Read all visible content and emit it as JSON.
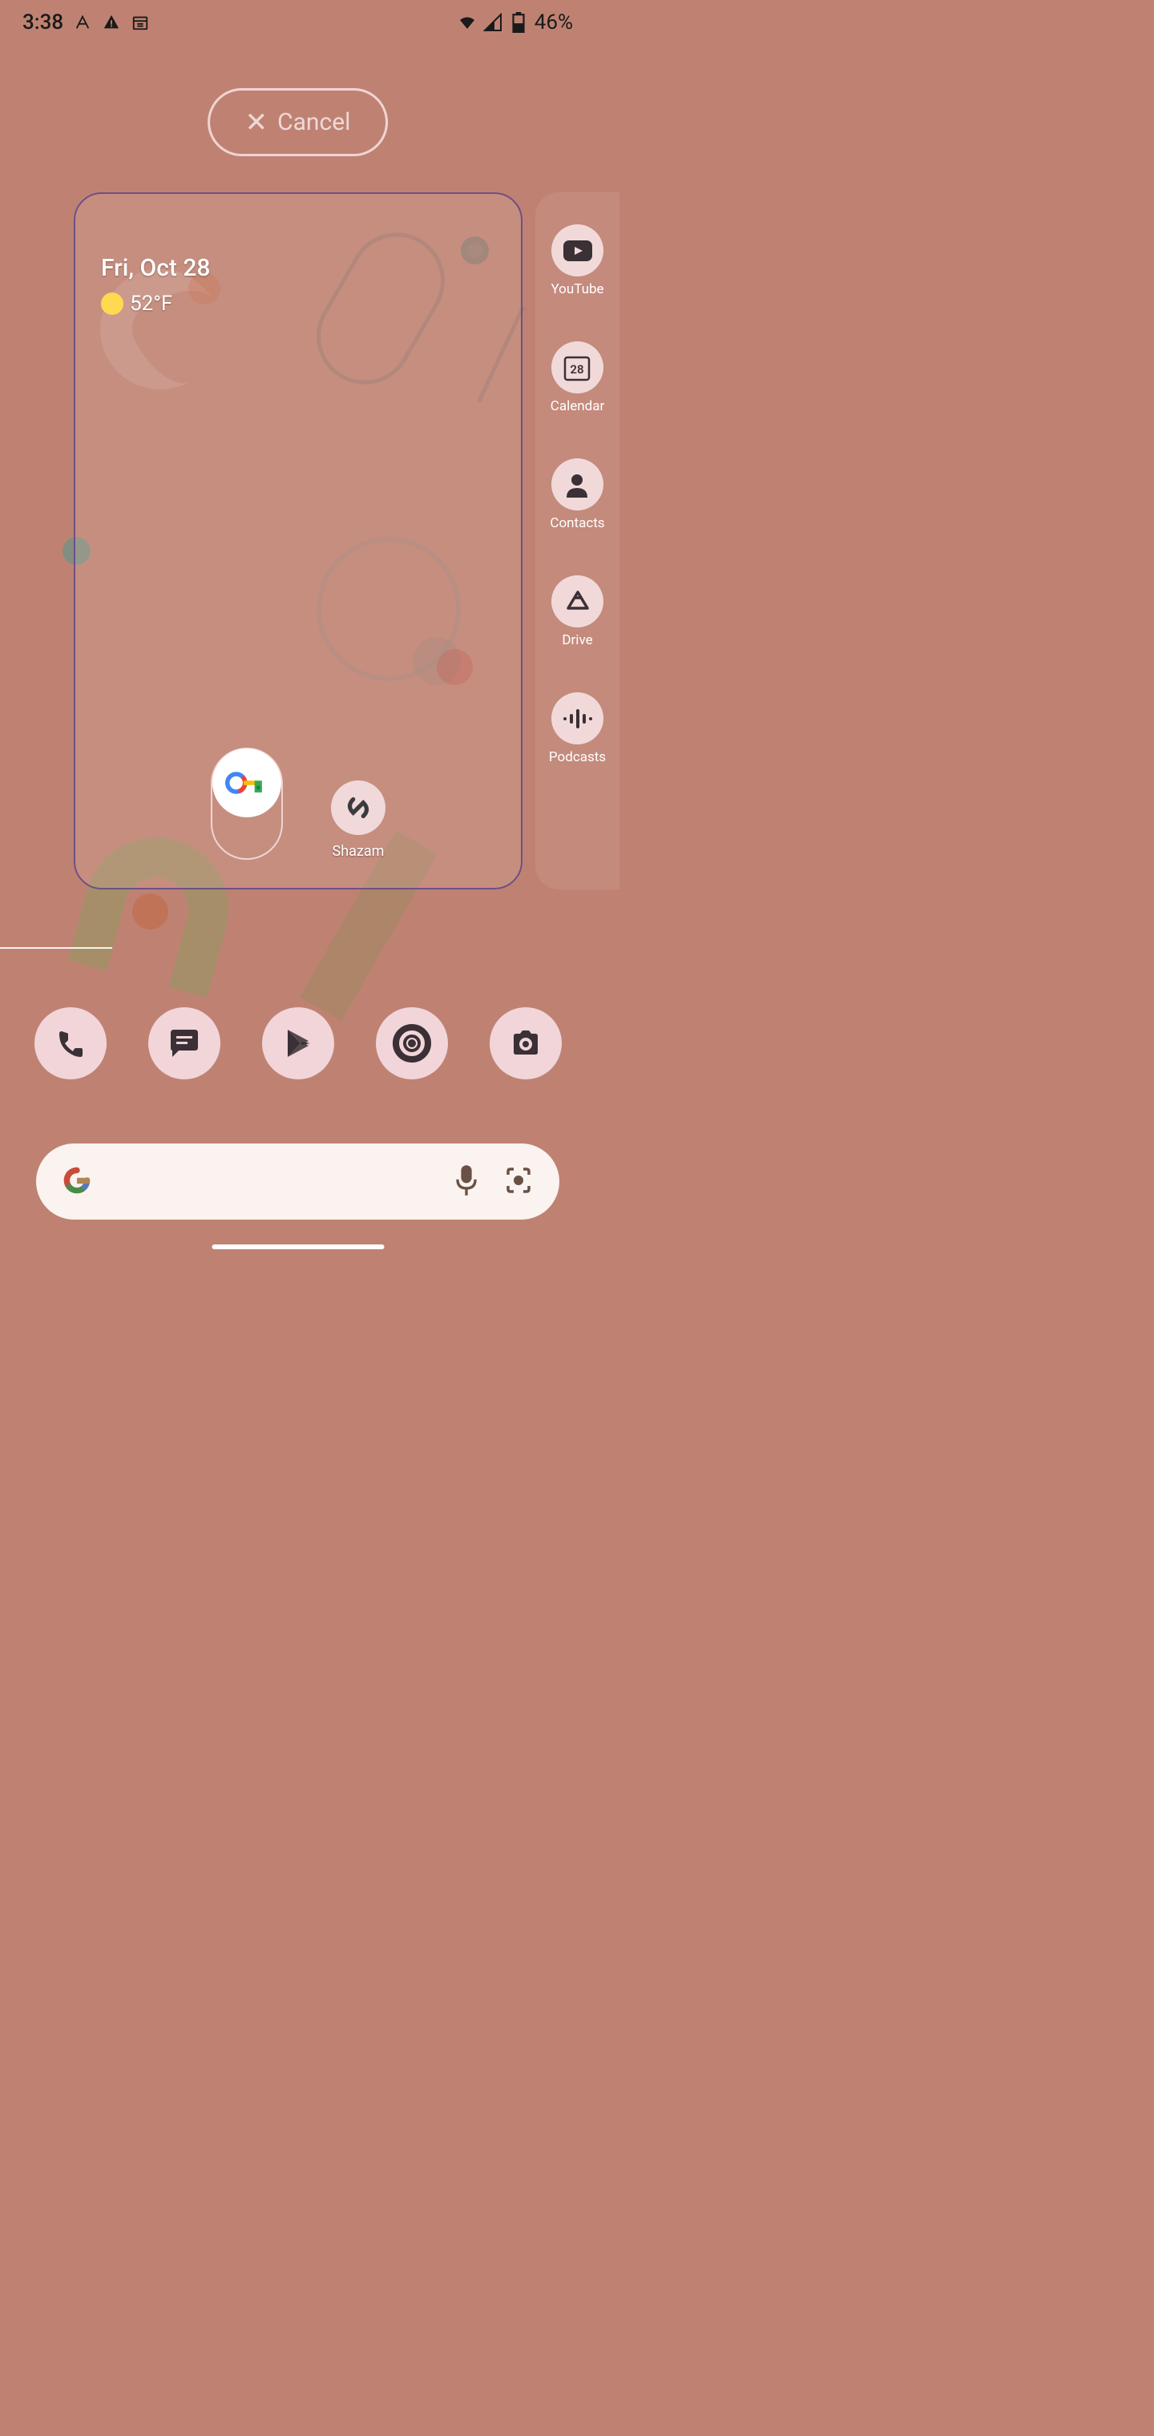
{
  "status": {
    "time": "3:38",
    "battery_pct": "46%"
  },
  "cancel": {
    "label": "Cancel"
  },
  "widget": {
    "date": "Fri, Oct 28",
    "temperature": "52°F"
  },
  "preview_apps": {
    "shazam": "Shazam"
  },
  "side_apps": [
    {
      "label": "YouTube",
      "glyph": "▶",
      "name": "youtube"
    },
    {
      "label": "Calendar",
      "glyph": "28",
      "name": "calendar"
    },
    {
      "label": "Contacts",
      "glyph": "👤",
      "name": "contacts"
    },
    {
      "label": "Drive",
      "glyph": "△",
      "name": "drive"
    },
    {
      "label": "Podcasts",
      "glyph": "⦿",
      "name": "podcasts"
    }
  ],
  "dock": [
    {
      "name": "phone"
    },
    {
      "name": "messages"
    },
    {
      "name": "play-store"
    },
    {
      "name": "chrome"
    },
    {
      "name": "camera"
    }
  ],
  "colors": {
    "background": "#bf8272",
    "icon_bg": "#f1d5d9",
    "accent_border": "#f0d5d3",
    "panel_border": "#6e5088"
  }
}
